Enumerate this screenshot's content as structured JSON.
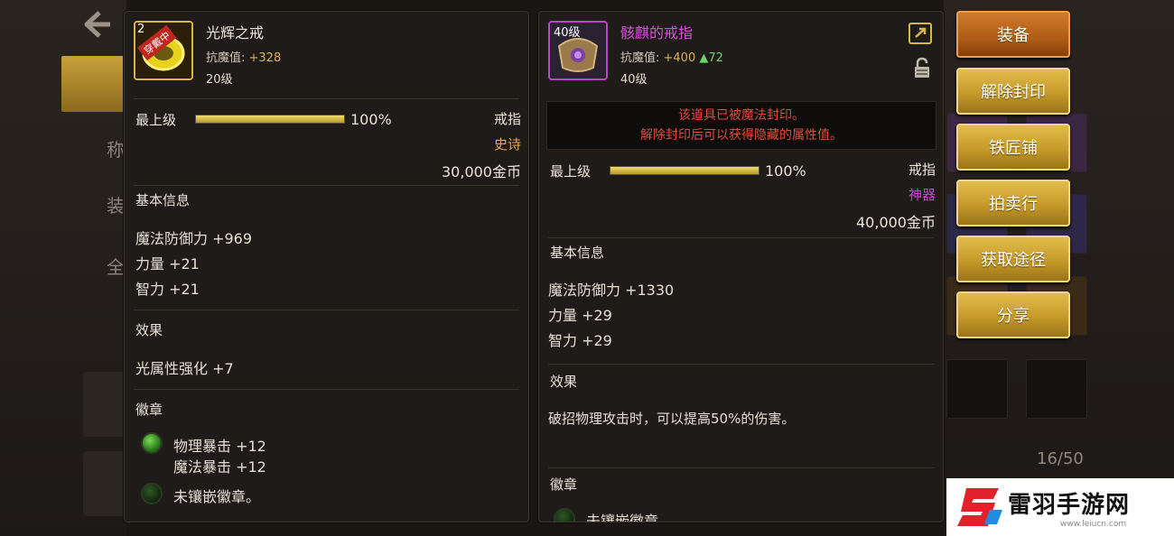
{
  "item1": {
    "icon_level": "2",
    "icon_tag": "穿戴中",
    "name": "光辉之戒",
    "resist_label": "抗魔值: ",
    "resist_value": "+328",
    "level": "20级",
    "grade_label": "最上级",
    "grade_percent": "100%",
    "grade_progress": 1.0,
    "slot_type": "戒指",
    "rarity": "史诗",
    "price": "30,000金币",
    "basic_title": "基本信息",
    "basic_stats": [
      "魔法防御力 +969",
      "力量 +21",
      "智力 +21"
    ],
    "effect_title": "效果",
    "effect_text": "光属性强化 +7",
    "emblem_title": "徽章",
    "emblem_lines": [
      "物理暴击 +12",
      "魔法暴击 +12"
    ],
    "emblem_empty": "未镶嵌徽章。"
  },
  "item2": {
    "icon_level": "40级",
    "name": "骸麒的戒指",
    "resist_label": "抗魔值: ",
    "resist_value": "+400",
    "resist_diff": "▲72",
    "level": "40级",
    "seal_line1": "该道具已被魔法封印。",
    "seal_line2": "解除封印后可以获得隐藏的属性值。",
    "grade_label": "最上级",
    "grade_percent": "100%",
    "grade_progress": 1.0,
    "slot_type": "戒指",
    "rarity": "神器",
    "price": "40,000金币",
    "basic_title": "基本信息",
    "basic_stats": [
      "魔法防御力 +1330",
      "力量 +29",
      "智力 +29"
    ],
    "effect_title": "效果",
    "effect_text": "破招物理攻击时，可以提高50%的伤害。",
    "emblem_title": "徽章",
    "emblem_empty": "未镶嵌徽章。"
  },
  "actions": {
    "equip": "装备",
    "unseal": "解除封印",
    "blacksmith": "铁匠铺",
    "auction": "拍卖行",
    "obtain": "获取途径",
    "share": "分享"
  },
  "inventory_count": "16/50",
  "watermark": {
    "title": "雷羽手游网",
    "url": "www.leiucn.com"
  },
  "colors": {
    "epic": "#e8a93c",
    "artifact": "#d43bd6",
    "item2_name": "#d64fd8",
    "seal": "#e34a3a",
    "resist_up": "#6ad36a",
    "resist_value": "#d8b060"
  },
  "icons": [
    "back-arrow-icon",
    "share-icon",
    "lock-icon",
    "gem-icon"
  ]
}
